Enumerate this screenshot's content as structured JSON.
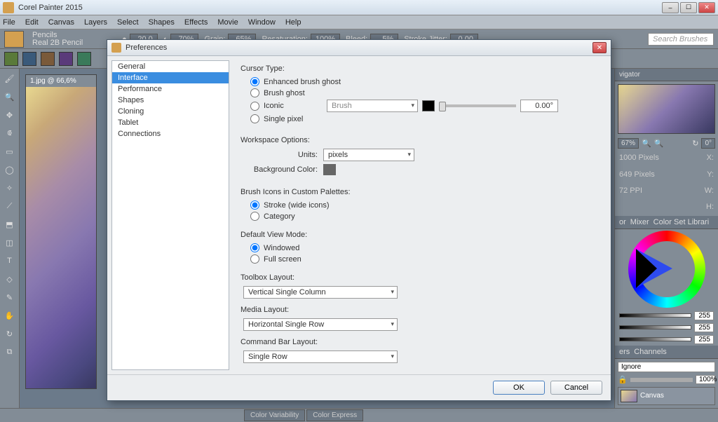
{
  "titlebar": {
    "text": "Corel Painter 2015"
  },
  "menu": [
    "File",
    "Edit",
    "Canvas",
    "Layers",
    "Select",
    "Shapes",
    "Effects",
    "Movie",
    "Window",
    "Help"
  ],
  "brush": {
    "category": "Pencils",
    "name": "Real 2B Pencil"
  },
  "propbar": {
    "size": "20.0",
    "opacity": "70%",
    "grain_label": "Grain:",
    "grain": "65%",
    "resat_label": "Resaturation:",
    "resat": "100%",
    "bleed_label": "Bleed:",
    "bleed": "5%",
    "jitter_label": "Stroke Jitter:",
    "jitter": "0.00"
  },
  "search_placeholder": "Search Brushes",
  "document": {
    "title": "1.jpg @ 66,6%"
  },
  "navigator": {
    "tab": "vigator",
    "zoom": "67%",
    "rotation": "0°",
    "width": "1000 Pixels",
    "height": "649 Pixels",
    "ppi": "72 PPI",
    "x_label": "X:",
    "y_label": "Y:",
    "w_label": "W:",
    "h_label": "H:"
  },
  "color_tabs": {
    "t1": "or",
    "t2": "Mixer",
    "t3": "Color Set Librari"
  },
  "rgb": {
    "r": "255",
    "g": "255",
    "b": "255"
  },
  "layer_tabs": {
    "t1": "ers",
    "t2": "Channels"
  },
  "layers": {
    "mode": "Ignore",
    "opacity": "100%",
    "item": "Canvas"
  },
  "status_tabs": {
    "t1": "Color Variability",
    "t2": "Color Express"
  },
  "dialog": {
    "title": "Preferences",
    "nav": [
      "General",
      "Interface",
      "Performance",
      "Shapes",
      "Cloning",
      "Tablet",
      "Connections"
    ],
    "cursor": {
      "label": "Cursor Type:",
      "opt1": "Enhanced brush ghost",
      "opt2": "Brush ghost",
      "opt3": "Iconic",
      "opt4": "Single pixel",
      "icon_dd": "Brush",
      "rotation": "0.00°"
    },
    "workspace": {
      "label": "Workspace Options:",
      "units_label": "Units:",
      "units": "pixels",
      "bgcolor_label": "Background Color:"
    },
    "brushicons": {
      "label": "Brush Icons in Custom Palettes:",
      "opt1": "Stroke (wide icons)",
      "opt2": "Category"
    },
    "viewmode": {
      "label": "Default View Mode:",
      "opt1": "Windowed",
      "opt2": "Full screen"
    },
    "toolbox": {
      "label": "Toolbox Layout:",
      "value": "Vertical Single Column"
    },
    "media": {
      "label": "Media Layout:",
      "value": "Horizontal Single Row"
    },
    "cmdbar": {
      "label": "Command Bar Layout:",
      "value": "Single Row"
    },
    "ok": "OK",
    "cancel": "Cancel"
  }
}
